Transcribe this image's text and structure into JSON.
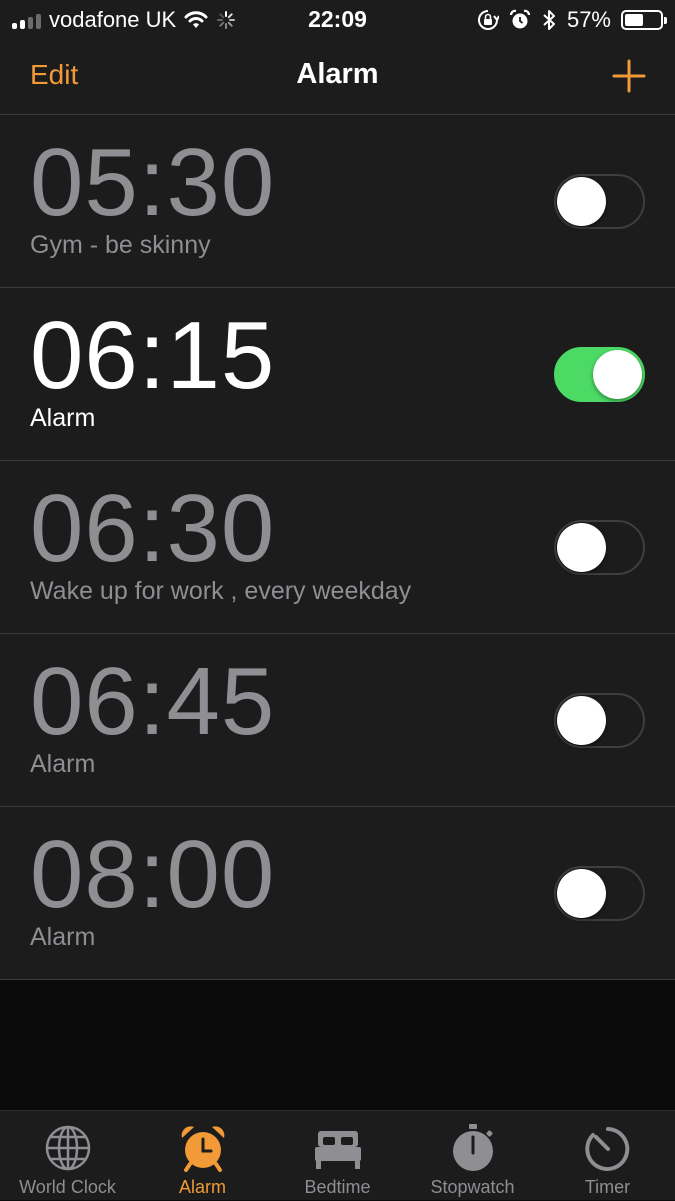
{
  "status_bar": {
    "carrier": "vodafone UK",
    "time": "22:09",
    "battery": "57%",
    "battery_level": 0.57,
    "icons": [
      "signal-icon",
      "wifi-icon",
      "activity-spinner-icon",
      "rotation-lock-icon",
      "alarm-clock-icon",
      "bluetooth-icon",
      "battery-icon"
    ]
  },
  "nav": {
    "edit_label": "Edit",
    "title": "Alarm",
    "add_icon": "plus-icon"
  },
  "alarms": [
    {
      "time": "05:30",
      "label": "Gym - be skinny",
      "enabled": false
    },
    {
      "time": "06:15",
      "label": "Alarm",
      "enabled": true
    },
    {
      "time": "06:30",
      "label": "Wake up for work , every weekday",
      "enabled": false
    },
    {
      "time": "06:45",
      "label": "Alarm",
      "enabled": false
    },
    {
      "time": "08:00",
      "label": "Alarm",
      "enabled": false
    }
  ],
  "tabs": [
    {
      "label": "World Clock",
      "icon": "globe-icon",
      "selected": false
    },
    {
      "label": "Alarm",
      "icon": "alarm-clock-icon",
      "selected": true
    },
    {
      "label": "Bedtime",
      "icon": "bed-icon",
      "selected": false
    },
    {
      "label": "Stopwatch",
      "icon": "stopwatch-icon",
      "selected": false
    },
    {
      "label": "Timer",
      "icon": "timer-icon",
      "selected": false
    }
  ],
  "colors": {
    "accent": "#f19a37",
    "toggle_on": "#4cd964",
    "inactive_text": "#8e8e93",
    "background": "#1c1c1c"
  }
}
